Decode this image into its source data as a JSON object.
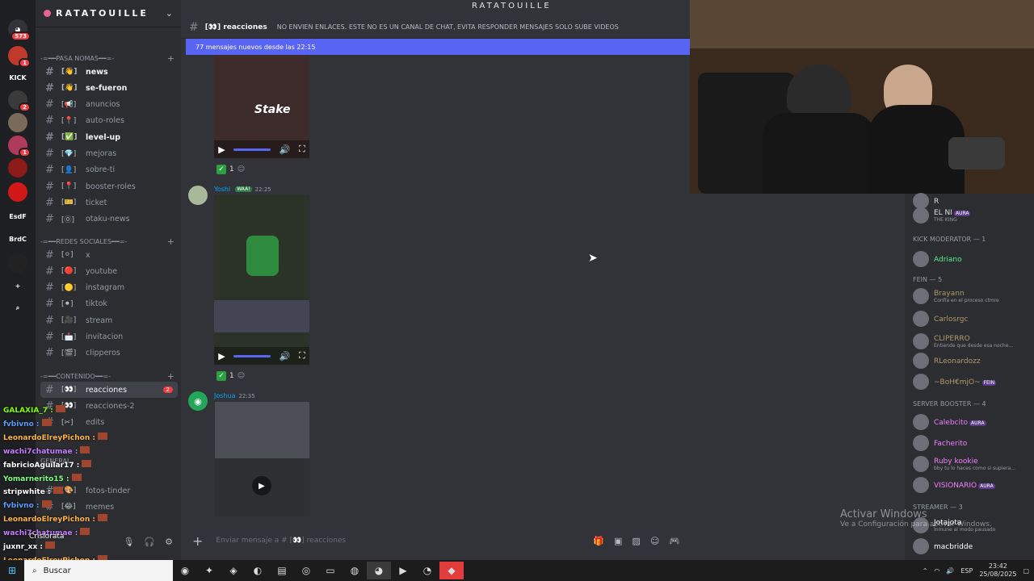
{
  "stream_name": "RATATOUILLE",
  "server": {
    "name": "RATATOUILLE",
    "chevron": "⌄"
  },
  "server_rail": {
    "home_badge": "573",
    "items": [
      {
        "label": "",
        "badge": "1",
        "color": "#c0392b"
      },
      {
        "label": "KICK",
        "badge": "",
        "color": "#1e1f22"
      },
      {
        "label": "",
        "badge": "2",
        "color": "#3a3a3a"
      },
      {
        "label": "",
        "badge": "",
        "color": "#7a6a5a"
      },
      {
        "label": "",
        "badge": "1",
        "color": "#b03a5a"
      },
      {
        "label": "",
        "badge": "",
        "color": "#8b1a1a"
      },
      {
        "label": "",
        "badge": "",
        "color": "#d01818"
      },
      {
        "label": "EsdF",
        "badge": "",
        "color": "#1e1f22"
      },
      {
        "label": "BrdC",
        "badge": "",
        "color": "#1e1f22"
      },
      {
        "label": "",
        "badge": "",
        "color": "#222"
      },
      {
        "label": "+",
        "badge": "",
        "color": "#1e1f22"
      },
      {
        "label": "⌕",
        "badge": "",
        "color": "#1e1f22"
      }
    ]
  },
  "categories": {
    "pasa_nomas": "-=━━PASA NOMAS━━=-",
    "redes": "-=━━REDES SOCIALES━━=-",
    "contenido": "-=━━CONTENIDO━━=-",
    "general": "GENERAL"
  },
  "channels": {
    "pasa": [
      {
        "emo": "[👋]",
        "name": "news",
        "unread": true
      },
      {
        "emo": "[👋]",
        "name": "se-fueron",
        "unread": true
      },
      {
        "emo": "[📢]",
        "name": "anuncios",
        "unread": false
      },
      {
        "emo": "[📍]",
        "name": "auto-roles",
        "unread": false
      },
      {
        "emo": "[✅]",
        "name": "level-up",
        "unread": true
      },
      {
        "emo": "[💎]",
        "name": "mejoras",
        "unread": false
      },
      {
        "emo": "[👤]",
        "name": "sobre-ti",
        "unread": false
      },
      {
        "emo": "[📍]",
        "name": "booster-roles",
        "unread": false
      },
      {
        "emo": "[🎫]",
        "name": "ticket",
        "unread": false
      },
      {
        "emo": "[⓪]",
        "name": "otaku-news",
        "unread": false
      }
    ],
    "redes": [
      {
        "emo": "[⚪]",
        "name": "x"
      },
      {
        "emo": "[🔴]",
        "name": "youtube"
      },
      {
        "emo": "[🟡]",
        "name": "instagram"
      },
      {
        "emo": "[⚫]",
        "name": "tiktok"
      },
      {
        "emo": "[🎥]",
        "name": "stream"
      },
      {
        "emo": "[📩]",
        "name": "invitacion"
      },
      {
        "emo": "[🎬]",
        "name": "clipperos"
      }
    ],
    "contenido": [
      {
        "emo": "[👀]",
        "name": "reacciones",
        "count": "2"
      },
      {
        "emo": "[👀]",
        "name": "reacciones-2"
      },
      {
        "emo": "[✂]",
        "name": "edits"
      },
      {
        "emo": "[🎨]",
        "name": "fotos-tinder"
      },
      {
        "emo": "[😂]",
        "name": "memes"
      }
    ]
  },
  "channel_header": {
    "name": "reacciones",
    "emo": "[👀]",
    "topic": "NO ENVIEN ENLACES. ESTE NO ES UN CANAL DE CHAT, EVITA RESPONDER MENSAJES SOLO SUBE VIDEOS"
  },
  "new_messages_bar": "77 mensajes nuevos desde las 22:15",
  "messages": [
    {
      "reaction_count": "1"
    },
    {
      "author": "Yoshi",
      "tag": "WAA!",
      "time": "22:25",
      "reaction_count": "1"
    },
    {
      "author": "Joshua",
      "time": "22:35"
    }
  ],
  "composer_placeholder": "Enviar mensaje a # [👀] reacciones",
  "members": {
    "top": [
      {
        "name": "R",
        "sub": ""
      },
      {
        "name": "EL NI",
        "tag": "AURA",
        "sub": "THE KING"
      }
    ],
    "groups": [
      {
        "header": "KICK MODERATOR — 1",
        "items": [
          {
            "name": "Adriano",
            "color": "#57f287",
            "sub": ""
          }
        ]
      },
      {
        "header": "FEIN — 5",
        "items": [
          {
            "name": "Brayann",
            "color": "#b09a6a",
            "sub": "Confía en el proceso ctmre"
          },
          {
            "name": "Carlosrgc",
            "color": "#b09a6a",
            "sub": ""
          },
          {
            "name": "CLIPERRO",
            "color": "#b09a6a",
            "sub": "Entiende que desde esa noche..."
          },
          {
            "name": "RLeonardozz",
            "color": "#b09a6a",
            "sub": ""
          },
          {
            "name": "~BoH€mjO~",
            "color": "#b09a6a",
            "tag": "FEIN",
            "sub": ""
          }
        ]
      },
      {
        "header": "SERVER BOOSTER — 4",
        "items": [
          {
            "name": "Calebcito",
            "color": "#f47fff",
            "tag": "AURA",
            "sub": ""
          },
          {
            "name": "Facherito",
            "color": "#f47fff",
            "sub": ""
          },
          {
            "name": "Ruby kookie",
            "color": "#f47fff",
            "sub": "bby tu lo haces como si supiera..."
          },
          {
            "name": "VISIONARIO",
            "color": "#f47fff",
            "tag": "AURA",
            "sub": ""
          }
        ]
      },
      {
        "header": "STREAMER — 3",
        "items": [
          {
            "name": "Jotajota",
            "color": "#ffffff",
            "sub": "Inmune al modo pausado"
          },
          {
            "name": "macbridde",
            "color": "#ffffff",
            "sub": ""
          }
        ]
      }
    ]
  },
  "chat_overlay": [
    {
      "user": "GALAXIA_7",
      "color": "#7fff00"
    },
    {
      "user": "fvbivno",
      "color": "#5b9bff"
    },
    {
      "user": "LeonardoElreyPichon",
      "color": "#ffb347"
    },
    {
      "user": "wachi7chatumae",
      "color": "#c77dff"
    },
    {
      "user": "fabricioAguilar17",
      "color": "#ffffff"
    },
    {
      "user": "Yomarnerito15",
      "color": "#7fff7f"
    },
    {
      "user": "stripwhite",
      "color": "#ffffff"
    },
    {
      "user": "fvbivno",
      "color": "#5b9bff"
    },
    {
      "user": "LeonardoElreyPichon",
      "color": "#ffb347"
    },
    {
      "user": "wachi7chatumae",
      "color": "#c77dff"
    },
    {
      "user": "juxnr_xx",
      "color": "#ffffff"
    },
    {
      "user": "LeonardoElreyPichon",
      "color": "#ffb347"
    }
  ],
  "user_panel": {
    "name": "Crislorata"
  },
  "watermark": {
    "title": "Activar Windows",
    "sub": "Ve a Configuración para activar Windows."
  },
  "taskbar": {
    "search": "Buscar",
    "lang": "ESP",
    "time": "23:42",
    "date": "25/08/2025"
  }
}
